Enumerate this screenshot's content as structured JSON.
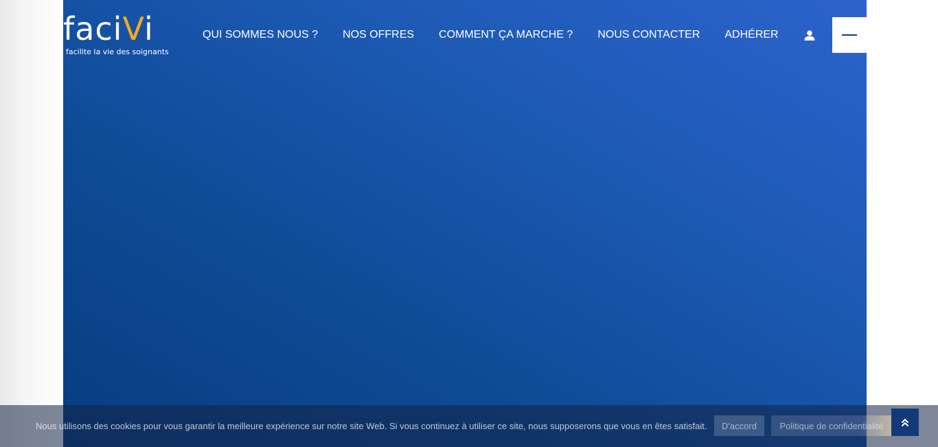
{
  "brand": {
    "logo_main": "faci",
    "logo_accent": "V",
    "logo_tail": "i",
    "tagline": "facilite la vie des soignants",
    "accent_color": "#f7a823"
  },
  "nav": {
    "items": [
      {
        "label": "QUI SOMMES NOUS ?"
      },
      {
        "label": "NOS OFFRES"
      },
      {
        "label": "COMMENT ÇA MARCHE ?"
      },
      {
        "label": "NOUS CONTACTER"
      },
      {
        "label": "ADHÉRER"
      }
    ],
    "user_icon": "user-icon",
    "menu_icon": "hamburger-menu-icon"
  },
  "hero": {
    "gradient_start": "#073d7f",
    "gradient_end": "#2d63cc"
  },
  "cookie_banner": {
    "message": "Nous utilisons des cookies pour vous garantir la meilleure expérience sur notre site Web. Si vous continuez à utiliser ce site, nous supposerons que vous en êtes satisfait.",
    "accept_label": "D'accord",
    "privacy_label": "Politique de confidentialité"
  },
  "scroll_top": {
    "icon": "double-chevron-up-icon"
  }
}
